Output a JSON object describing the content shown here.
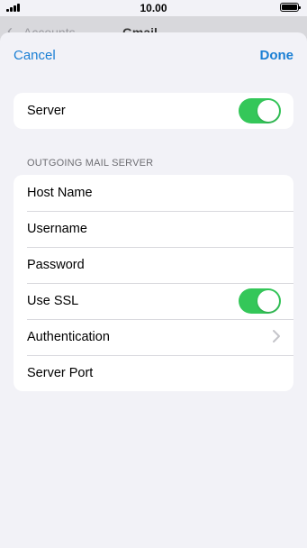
{
  "status_bar": {
    "time": "10.00"
  },
  "underlying_nav": {
    "back_label": "Accounts",
    "title": "Gmail"
  },
  "nav": {
    "cancel_label": "Cancel",
    "done_label": "Done"
  },
  "server_group": {
    "label": "Server",
    "toggle_on": true
  },
  "outgoing": {
    "header": "OUTGOING MAIL SERVER",
    "rows": [
      {
        "label": "Host Name"
      },
      {
        "label": "Username"
      },
      {
        "label": "Password"
      },
      {
        "label": "Use SSL",
        "toggle_on": true
      },
      {
        "label": "Authentication"
      },
      {
        "label": "Server Port"
      }
    ]
  },
  "colors": {
    "accent": "#1a7fd4",
    "toggle_on": "#34c759",
    "background": "#f2f2f7"
  }
}
